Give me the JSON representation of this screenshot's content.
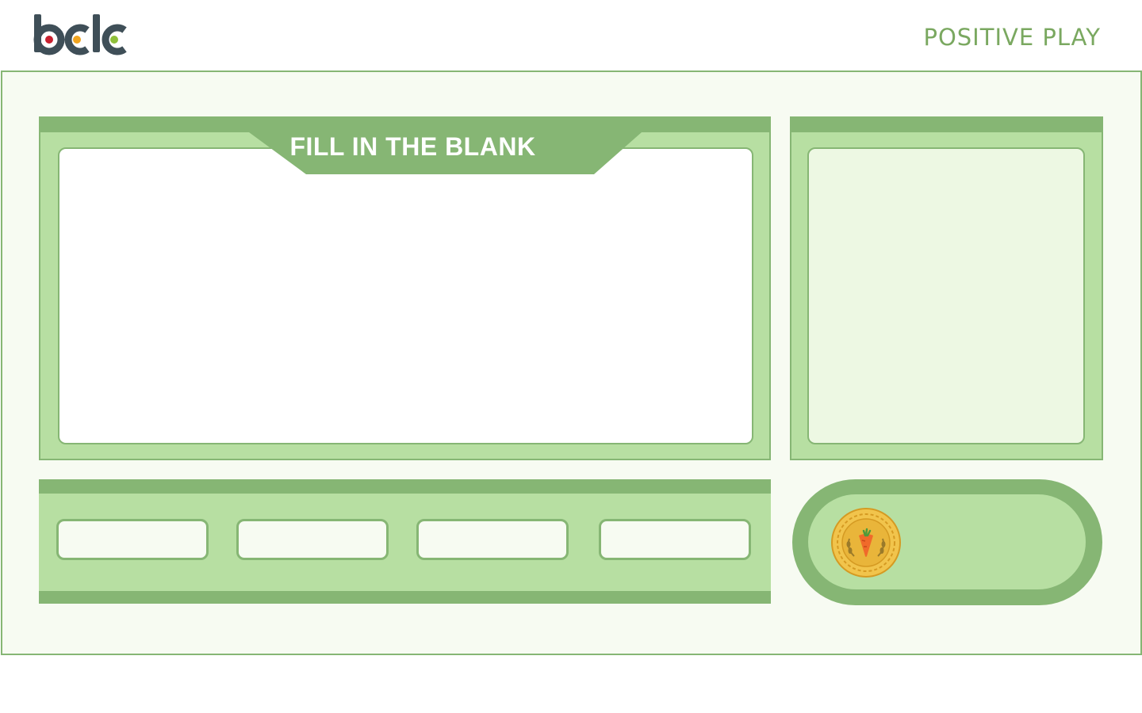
{
  "header": {
    "logo_text": "bclc",
    "brand_title": "POSITIVE PLAY"
  },
  "question_panel": {
    "title": "FILL IN THE BLANK"
  },
  "answers": [
    {
      "label": ""
    },
    {
      "label": ""
    },
    {
      "label": ""
    },
    {
      "label": ""
    }
  ],
  "colors": {
    "green_dark": "#86b674",
    "green_mid": "#b7dfa2",
    "green_light": "#edf8e3",
    "background": "#f7fbf2",
    "coin_gold": "#e9b53a",
    "carrot": "#f06a2a"
  },
  "icons": {
    "coin": "carrot-coin-icon"
  }
}
